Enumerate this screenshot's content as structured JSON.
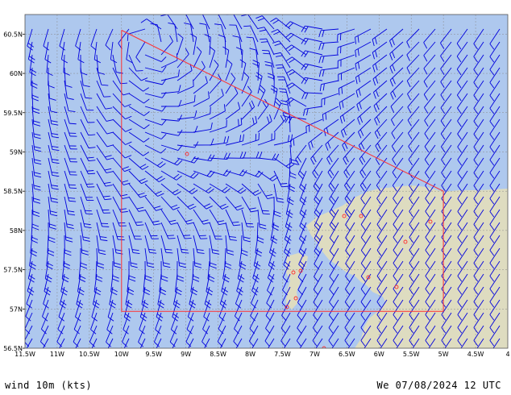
{
  "map": {
    "lat_labels": [
      "60.5N",
      "60N",
      "59.5N",
      "59N",
      "58.5N",
      "58N",
      "57.5N",
      "57N",
      "56.5N"
    ],
    "lon_labels": [
      "11.5W",
      "11W",
      "10.5W",
      "10W",
      "9.5W",
      "9W",
      "8.5W",
      "8W",
      "7.5W",
      "7W",
      "6.5W",
      "6W",
      "5.5W",
      "5W",
      "4.5W",
      "4"
    ],
    "colors": {
      "sea": "#aec8ee",
      "land": "#dedcc0",
      "grid": "#8a8a8a",
      "barbs": "#0000dd",
      "region_outline": "#ff3030",
      "markers": "#ff3030"
    },
    "region_outline_latlon": [
      [
        60.55,
        -10.0
      ],
      [
        58.5,
        -5.0
      ],
      [
        56.97,
        -5.0
      ],
      [
        56.97,
        -10.0
      ]
    ]
  },
  "footer": {
    "left": "wind 10m (kts)",
    "right": "We 07/08/2024 12 UTC"
  }
}
